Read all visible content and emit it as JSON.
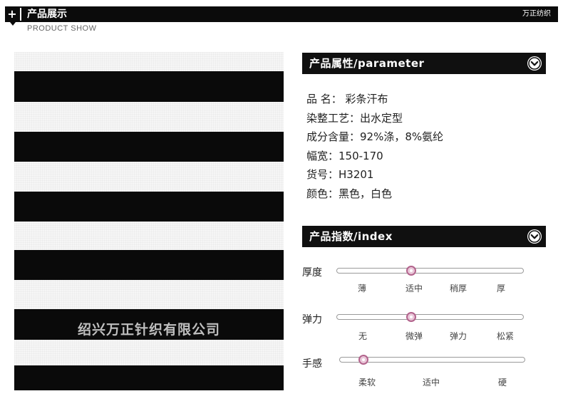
{
  "header": {
    "plus_symbol": "+",
    "title": "产品展示",
    "brand": "万正纺织",
    "subtitle": "PRODUCT SHOW"
  },
  "product_image": {
    "watermark": "绍兴万正针织有限公司",
    "colors": {
      "stripe_dark": "#0a0a0a",
      "stripe_light": "#f6f6f6"
    }
  },
  "parameter_section": {
    "title": "产品属性/parameter",
    "rows": [
      "品 名： 彩条汗布",
      "染整工艺：出水定型",
      "成分含量：92%涤，8%氨纶",
      "幅宽：150-170",
      "货号：H3201",
      "颜色：黑色，白色"
    ]
  },
  "index_section": {
    "title": "产品指数/index",
    "sliders": [
      {
        "label": "厚度",
        "ticks": [
          "薄",
          "适中",
          "稍厚",
          "厚"
        ],
        "level": "适中"
      },
      {
        "label": "弹力",
        "ticks": [
          "无",
          "微弹",
          "弹力",
          "松紧"
        ],
        "level": "微弹"
      },
      {
        "label": "手感",
        "ticks": [
          "柔软",
          "适中",
          "硬"
        ],
        "level": "柔软"
      }
    ]
  },
  "colors": {
    "header_bg": "#0b0b0b",
    "knob_border": "#b2638c",
    "knob_fill": "#e9c6d8"
  },
  "icons": {
    "section_toggle": "chevron-down-circle-icon"
  }
}
